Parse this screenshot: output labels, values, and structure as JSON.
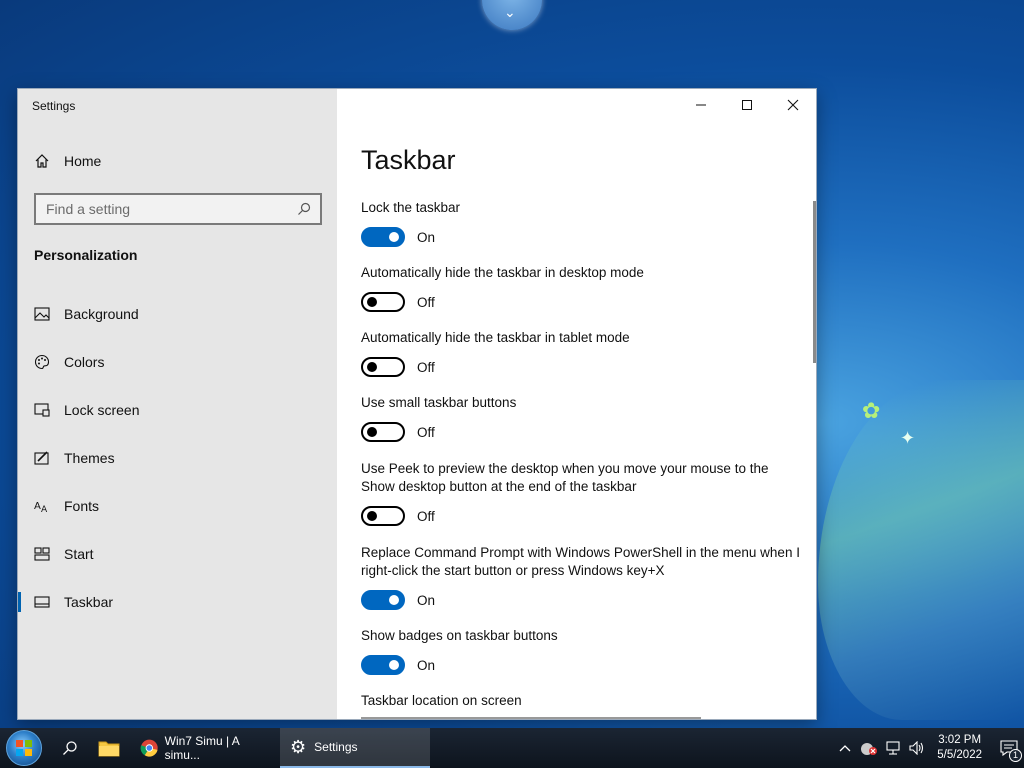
{
  "window": {
    "title": "Settings",
    "controls": {
      "minimize": "minimize",
      "maximize": "maximize",
      "close": "close"
    }
  },
  "sidebar": {
    "home_label": "Home",
    "search_placeholder": "Find a setting",
    "section_heading": "Personalization",
    "items": [
      {
        "label": "Background",
        "icon": "picture-icon"
      },
      {
        "label": "Colors",
        "icon": "palette-icon"
      },
      {
        "label": "Lock screen",
        "icon": "lock-screen-icon"
      },
      {
        "label": "Themes",
        "icon": "themes-icon"
      },
      {
        "label": "Fonts",
        "icon": "fonts-icon"
      },
      {
        "label": "Start",
        "icon": "start-icon"
      },
      {
        "label": "Taskbar",
        "icon": "taskbar-icon",
        "selected": true
      }
    ]
  },
  "main": {
    "title": "Taskbar",
    "settings": [
      {
        "label": "Lock the taskbar",
        "state": "On",
        "on": true
      },
      {
        "label": "Automatically hide the taskbar in desktop mode",
        "state": "Off",
        "on": false
      },
      {
        "label": "Automatically hide the taskbar in tablet mode",
        "state": "Off",
        "on": false
      },
      {
        "label": "Use small taskbar buttons",
        "state": "Off",
        "on": false
      },
      {
        "label": "Use Peek to preview the desktop when you move your mouse to the Show desktop button at the end of the taskbar",
        "state": "Off",
        "on": false
      },
      {
        "label": "Replace Command Prompt with Windows PowerShell in the menu when I right-click the start button or press Windows key+X",
        "state": "On",
        "on": true
      },
      {
        "label": "Show badges on taskbar buttons",
        "state": "On",
        "on": true
      }
    ],
    "location_label": "Taskbar location on screen"
  },
  "taskbar": {
    "apps": [
      {
        "label": "Win7 Simu | A simu...",
        "icon": "chrome-icon"
      },
      {
        "label": "Settings",
        "icon": "gear-icon",
        "active": true
      }
    ],
    "clock_time": "3:02 PM",
    "clock_date": "5/5/2022",
    "notification_count": "1"
  },
  "colors": {
    "accent": "#0067c0",
    "sidebar_bg": "#e6e6e6",
    "taskbar_bg": "#0d141d"
  }
}
